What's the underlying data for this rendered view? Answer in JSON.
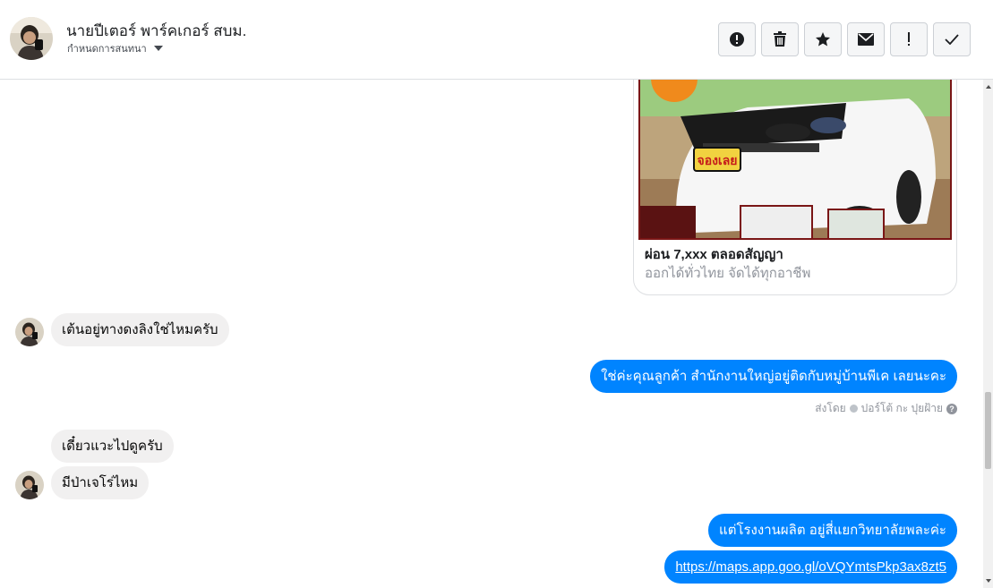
{
  "header": {
    "name": "นายปีเตอร์ พาร์คเกอร์ สบม.",
    "assign_label": "กำหนดการสนทนา"
  },
  "toolbar": {
    "buttons": [
      {
        "name": "spam",
        "icon": "alert-circle-icon"
      },
      {
        "name": "delete",
        "icon": "trash-icon"
      },
      {
        "name": "star",
        "icon": "star-icon"
      },
      {
        "name": "mark-unread",
        "icon": "envelope-icon"
      },
      {
        "name": "important",
        "icon": "exclamation-icon"
      },
      {
        "name": "done",
        "icon": "checkmark-icon"
      }
    ]
  },
  "link_preview": {
    "image_text": "จองเลย",
    "title": "ผ่อน 7,xxx ตลอดสัญญา",
    "description": "ออกได้ทั่วไทย จัดได้ทุกอาชีพ"
  },
  "messages": [
    {
      "direction": "in",
      "text": "เต้นอยู่ทางดงลิงใช่ไหมครับ"
    },
    {
      "direction": "out",
      "text": "ใช่ค่ะคุณลูกค้า สำนักงานใหญ่อยู่ติดกับหมู่บ้านพีเค เลยนะคะ"
    },
    {
      "direction": "in",
      "text": "เดี๋ยวแวะไปดูครับ"
    },
    {
      "direction": "in",
      "text": "มีป่าเจโร่ไหม"
    },
    {
      "direction": "out",
      "text": "แต่โรงงานผลิต อยู่สี่แยกวิทยาลัยพละค่ะ"
    },
    {
      "direction": "out",
      "text": "https://maps.app.goo.gl/oVQYmtsPkp3ax8zt5"
    }
  ],
  "sent_by": {
    "prefix": "ส่งโดย",
    "sender": "ปอร์โต้ กะ ปุยฝ้าย"
  },
  "colors": {
    "outgoing_bubble": "#0084ff",
    "incoming_bubble": "#f1f0f0"
  }
}
